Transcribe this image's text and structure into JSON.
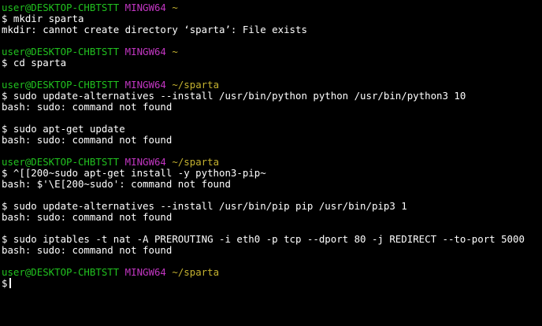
{
  "terminal": {
    "user": "user@DESKTOP-CHBTSTT",
    "shell": "MINGW64",
    "blocks": [
      {
        "path": "~",
        "command": "$ mkdir sparta",
        "output": "mkdir: cannot create directory ‘sparta’: File exists"
      },
      {
        "path": "~",
        "command": "$ cd sparta",
        "output": null
      },
      {
        "path": "~/sparta",
        "command": "$ sudo update-alternatives --install /usr/bin/python python /usr/bin/python3 10",
        "output": "bash: sudo: command not found"
      },
      {
        "path": "~/sparta",
        "command": "$ sudo apt-get update",
        "output": "bash: sudo: command not found"
      },
      {
        "path": "~/sparta",
        "command": "$ ^[[200~sudo apt-get install -y python3-pip~",
        "output": "bash: $'\\E[200~sudo': command not found"
      },
      {
        "path": "~/sparta",
        "command": "$ sudo update-alternatives --install /usr/bin/pip pip /usr/bin/pip3 1",
        "output": "bash: sudo: command not found"
      },
      {
        "path": "~/sparta",
        "command": "$ sudo iptables -t nat -A PREROUTING -i eth0 -p tcp --dport 80 -j REDIRECT --to-port 5000",
        "output": "bash: sudo: command not found"
      },
      {
        "path": "~/sparta",
        "command": "$",
        "output": null
      }
    ]
  },
  "colors": {
    "background": "#000000",
    "user_host": "#21c21f",
    "shell": "#c236c2",
    "path": "#c5b230",
    "text": "#ffffff"
  }
}
